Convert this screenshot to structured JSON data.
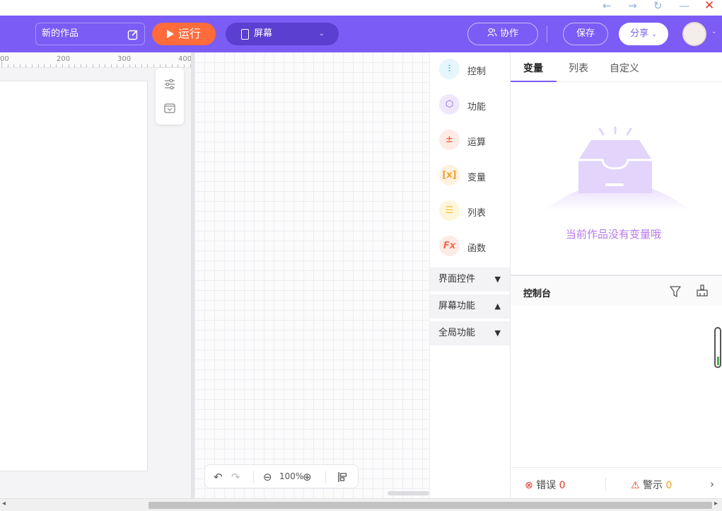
{
  "window": {
    "back_icon": "arrow-left-icon",
    "forward_icon": "arrow-right-icon",
    "refresh_icon": "refresh-icon",
    "minimize_icon": "minimize-icon",
    "close_icon": "close-icon"
  },
  "toolbar": {
    "project_title": "新的作品",
    "run_label": "运行",
    "screen_label": "屏幕",
    "collab_label": "协作",
    "save_label": "保存",
    "share_label": "分享",
    "accent_color": "#7b5cf5",
    "run_color": "#ff6b3b"
  },
  "ruler": {
    "labels": [
      "00",
      "200",
      "300",
      "400"
    ]
  },
  "zoom": {
    "value": "100%"
  },
  "categories": [
    {
      "label": "控制",
      "icon": "sliders-icon",
      "color": "#35b9e6"
    },
    {
      "label": "功能",
      "icon": "hexagon-y-icon",
      "color": "#8a5cf0"
    },
    {
      "label": "运算",
      "icon": "math-ops-icon",
      "color": "#f26b4a"
    },
    {
      "label": "变量",
      "icon": "variable-x-icon",
      "color": "#f0a030"
    },
    {
      "label": "列表",
      "icon": "list-icon",
      "color": "#f2c230"
    },
    {
      "label": "函数",
      "icon": "fx-icon",
      "color": "#f26b4a"
    }
  ],
  "groups": [
    {
      "label": "界面控件",
      "state": "collapsed"
    },
    {
      "label": "屏幕功能",
      "state": "expanded"
    },
    {
      "label": "全局功能",
      "state": "collapsed"
    }
  ],
  "panel": {
    "tabs": [
      "变量",
      "列表",
      "自定义"
    ],
    "active_tab": "变量",
    "empty_message": "当前作品没有变量哦",
    "console_title": "控制台",
    "error_label": "错误",
    "error_count": "0",
    "warning_label": "警示",
    "warning_count": "0"
  }
}
